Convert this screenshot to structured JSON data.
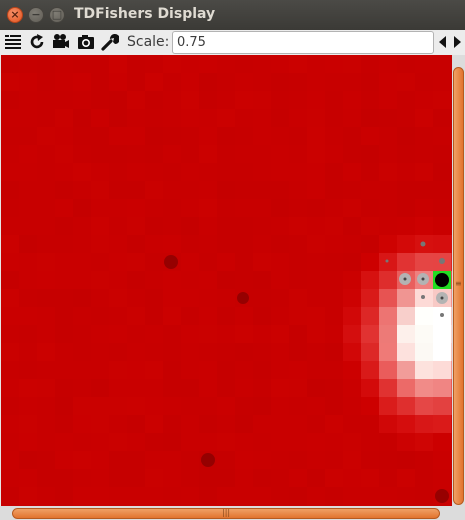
{
  "window": {
    "title": "TDFishers Display"
  },
  "toolbar": {
    "icons": [
      "menu-icon",
      "refresh-icon",
      "video-camera-icon",
      "camera-icon",
      "wrench-icon"
    ],
    "scale_label": "Scale:",
    "scale_value": "0.75",
    "arrows_icon": "left-right-arrows-icon"
  },
  "colors": {
    "background_red": "#cc0000",
    "highlight_green": "#22dd22",
    "titlebar": "#3c3b37",
    "scrollbar_accent": "#e2742e"
  }
}
